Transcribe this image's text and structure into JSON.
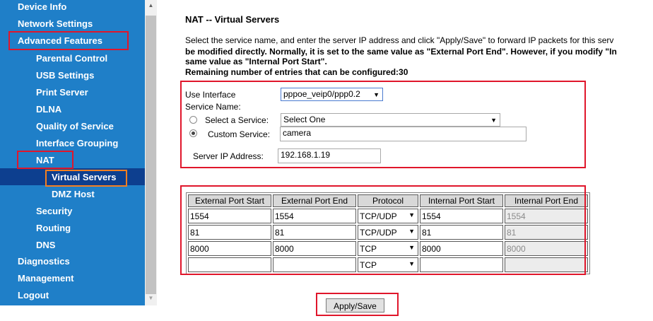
{
  "sidebar": {
    "items": [
      {
        "label": "Device Info"
      },
      {
        "label": "Network Settings"
      },
      {
        "label": "Advanced Features"
      },
      {
        "label": "Parental Control"
      },
      {
        "label": "USB Settings"
      },
      {
        "label": "Print Server"
      },
      {
        "label": "DLNA"
      },
      {
        "label": "Quality of Service"
      },
      {
        "label": "Interface Grouping"
      },
      {
        "label": "NAT"
      },
      {
        "label": "Virtual Servers"
      },
      {
        "label": "DMZ Host"
      },
      {
        "label": "Security"
      },
      {
        "label": "Routing"
      },
      {
        "label": "DNS"
      },
      {
        "label": "Diagnostics"
      },
      {
        "label": "Management"
      },
      {
        "label": "Logout"
      }
    ],
    "bg_color": "#1f7fc8",
    "active_bg_color": "#0d3f8f"
  },
  "page": {
    "title": "NAT -- Virtual Servers",
    "desc_line1": "Select the service name, and enter the server IP address and click \"Apply/Save\" to forward IP packets for this serv",
    "desc_line2": "be modified directly. Normally, it is set to the same value as \"External Port End\". However, if you modify \"In",
    "desc_line3": "same value as \"Internal Port Start\".",
    "remaining": "Remaining number of entries that can be configured:30"
  },
  "form": {
    "use_interface_label": "Use Interface",
    "use_interface_value": "pppoe_veip0/ppp0.2",
    "service_name_label": "Service Name:",
    "select_service_label": "Select a Service:",
    "select_service_value": "Select One",
    "custom_service_label": "Custom Service:",
    "custom_service_value": "camera",
    "server_ip_label": "Server IP Address:",
    "server_ip_value": "192.168.1.19"
  },
  "table": {
    "headers": [
      "External Port Start",
      "External Port End",
      "Protocol",
      "Internal Port Start",
      "Internal Port End"
    ],
    "rows": [
      {
        "ext_start": "1554",
        "ext_end": "1554",
        "protocol": "TCP/UDP",
        "int_start": "1554",
        "int_end": "1554"
      },
      {
        "ext_start": "81",
        "ext_end": "81",
        "protocol": "TCP/UDP",
        "int_start": "81",
        "int_end": "81"
      },
      {
        "ext_start": "8000",
        "ext_end": "8000",
        "protocol": "TCP",
        "int_start": "8000",
        "int_end": "8000"
      },
      {
        "ext_start": "",
        "ext_end": "",
        "protocol": "TCP",
        "int_start": "",
        "int_end": ""
      }
    ]
  },
  "actions": {
    "apply_label": "Apply/Save"
  },
  "colors": {
    "highlight_red": "#e0162b",
    "highlight_orange": "#f57f20"
  }
}
